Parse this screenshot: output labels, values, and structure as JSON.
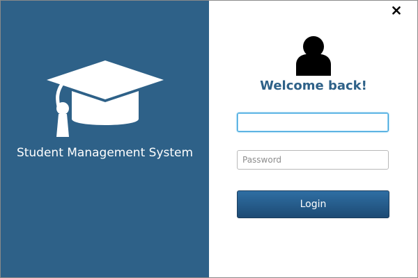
{
  "app": {
    "title": "Student Management System",
    "logo_icon": "graduation-cap-icon"
  },
  "login": {
    "welcome_text": "Welcome back!",
    "user_icon": "user-silhouette-icon",
    "username": {
      "value": "",
      "placeholder": ""
    },
    "password": {
      "value": "",
      "placeholder": "Password"
    },
    "login_label": "Login"
  },
  "window": {
    "close_icon": "close-icon"
  },
  "colors": {
    "panel": "#2e6188",
    "accent": "#2e6188",
    "button_top": "#2f6ea3",
    "button_bottom": "#1d4b74",
    "focus": "#3aa0d8"
  }
}
